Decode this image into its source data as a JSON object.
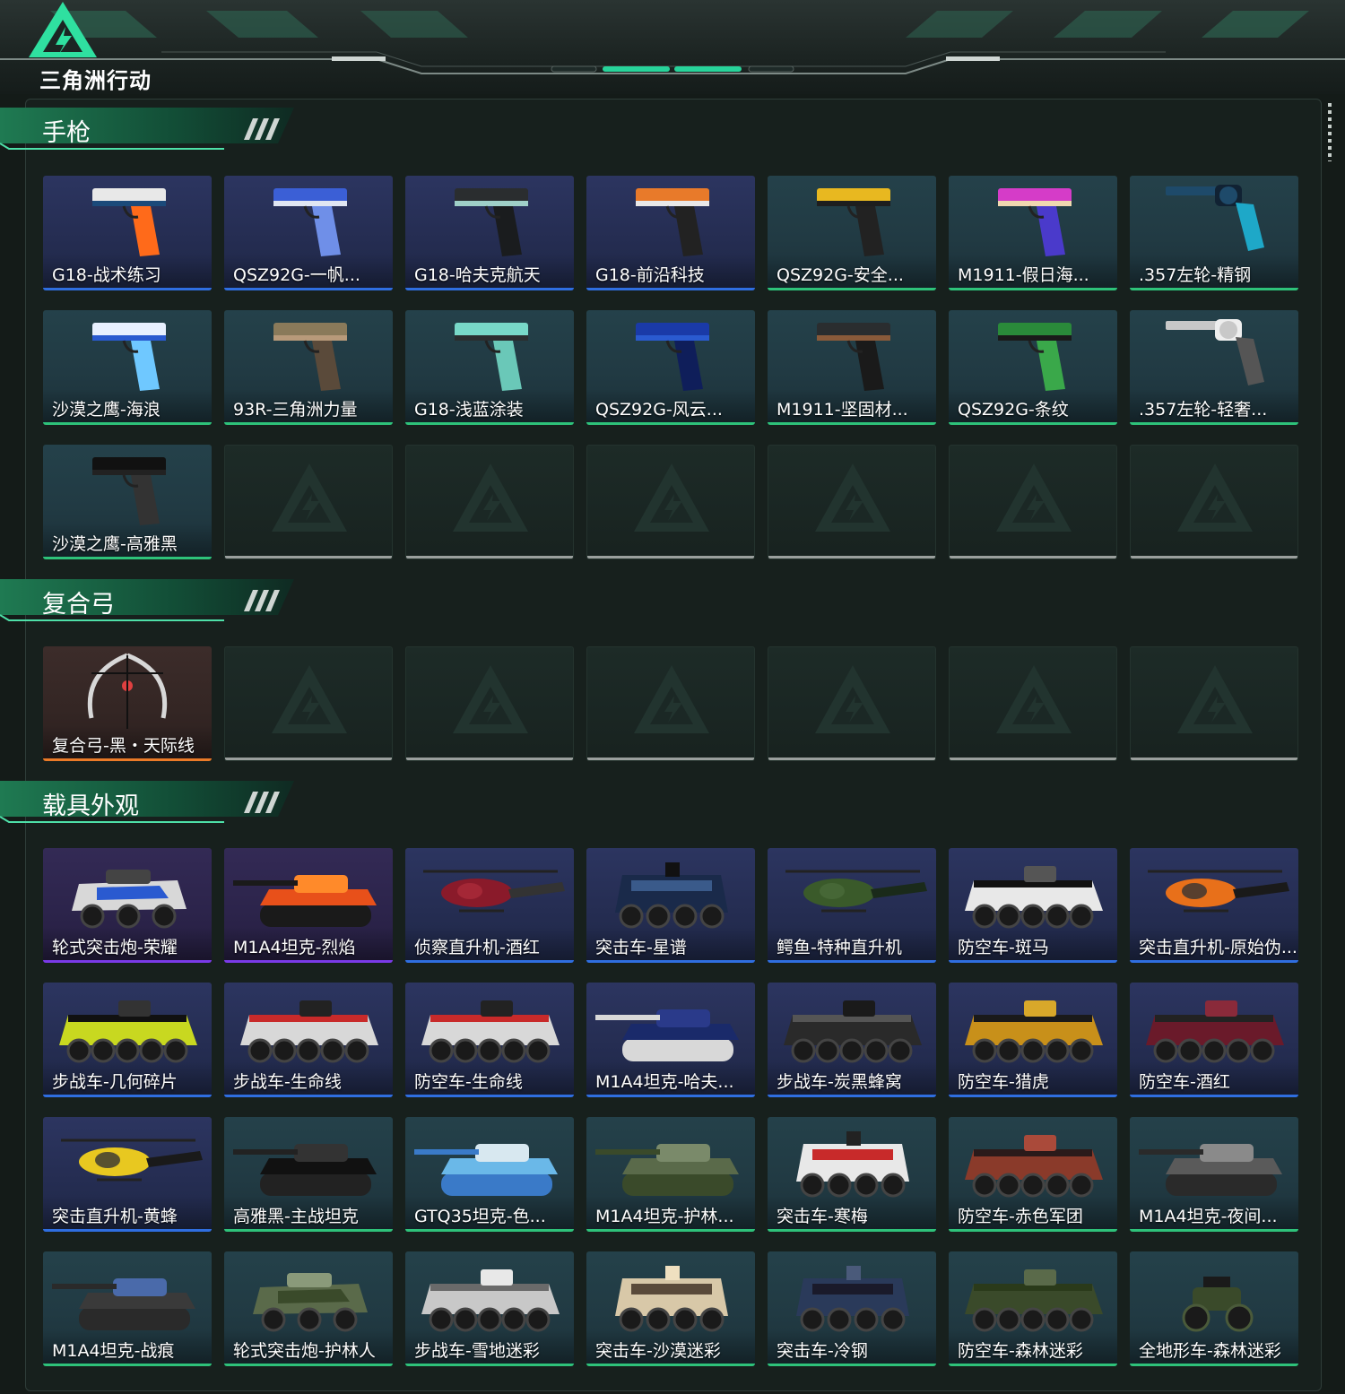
{
  "header": {
    "logo_text": "三角洲行动"
  },
  "sections": [
    {
      "title": "手枪",
      "rows": [
        [
          {
            "label": "G18-战术练习",
            "rarity": "blue",
            "icon": "pistol-icon",
            "colors": [
              "#e8e8e8",
              "#1b4a7a",
              "#ff6a1a"
            ]
          },
          {
            "label": "QSZ92G-一帆...",
            "rarity": "blue",
            "icon": "pistol-icon",
            "colors": [
              "#3b5fd6",
              "#e0e6f2",
              "#6f8fe8"
            ]
          },
          {
            "label": "G18-哈夫克航天",
            "rarity": "blue",
            "icon": "pistol-icon",
            "colors": [
              "#2a2d2f",
              "#9fd0c8",
              "#1a1c1e"
            ]
          },
          {
            "label": "G18-前沿科技",
            "rarity": "blue",
            "icon": "pistol-icon",
            "colors": [
              "#e87a2a",
              "#e8e8e8",
              "#222"
            ]
          },
          {
            "label": "QSZ92G-安全...",
            "rarity": "green",
            "icon": "pistol-icon",
            "colors": [
              "#e8b820",
              "#1e1e1e",
              "#222"
            ]
          },
          {
            "label": "M1911-假日海...",
            "rarity": "green",
            "icon": "pistol-icon",
            "colors": [
              "#d53cc8",
              "#f0d8b0",
              "#4a3acb"
            ]
          },
          {
            "label": ".357左轮-精钢",
            "rarity": "green",
            "icon": "revolver-icon",
            "colors": [
              "#1e4a6a",
              "#1ea8c8",
              "#123"
            ]
          }
        ],
        [
          {
            "label": "沙漠之鹰-海浪",
            "rarity": "green",
            "icon": "pistol-icon",
            "colors": [
              "#e8f0ff",
              "#2a5ad0",
              "#6fc8ff"
            ]
          },
          {
            "label": "93R-三角洲力量",
            "rarity": "green",
            "icon": "pistol-icon",
            "colors": [
              "#8a7a5a",
              "#b89a7a",
              "#5a4a3a"
            ]
          },
          {
            "label": "G18-浅蓝涂装",
            "rarity": "green",
            "icon": "pistol-icon",
            "colors": [
              "#78d8c8",
              "#2a2d2f",
              "#6ac8b8"
            ]
          },
          {
            "label": "QSZ92G-风云...",
            "rarity": "green",
            "icon": "pistol-icon",
            "colors": [
              "#1a3aa8",
              "#2a5ad0",
              "#0f1e5a"
            ]
          },
          {
            "label": "M1911-坚固材...",
            "rarity": "green",
            "icon": "pistol-icon",
            "colors": [
              "#2a2d2f",
              "#8a5a3a",
              "#1a1a1a"
            ]
          },
          {
            "label": "QSZ92G-条纹",
            "rarity": "green",
            "icon": "pistol-icon",
            "colors": [
              "#2a8a3a",
              "#1a1a1a",
              "#3aa84a"
            ]
          },
          {
            "label": ".357左轮-轻奢...",
            "rarity": "green",
            "icon": "revolver-icon",
            "colors": [
              "#c8c8c8",
              "#555",
              "#eee"
            ]
          }
        ],
        [
          {
            "label": "沙漠之鹰-高雅黑",
            "rarity": "green",
            "icon": "pistol-icon",
            "colors": [
              "#111",
              "#222",
              "#333"
            ]
          },
          null,
          null,
          null,
          null,
          null,
          null
        ]
      ]
    },
    {
      "title": "复合弓",
      "rows": [
        [
          {
            "label": "复合弓-黑・天际线",
            "rarity": "orange",
            "icon": "bow-icon",
            "colors": [
              "#d8d8d8",
              "#111",
              "#e04040"
            ]
          },
          null,
          null,
          null,
          null,
          null,
          null
        ]
      ]
    },
    {
      "title": "载具外观",
      "rows": [
        [
          {
            "label": "轮式突击炮-荣耀",
            "rarity": "purple",
            "icon": "armored-car-icon",
            "colors": [
              "#d8d8d8",
              "#2a5ad0",
              "#444"
            ]
          },
          {
            "label": "M1A4坦克-烈焰",
            "rarity": "purple",
            "icon": "tank-icon",
            "colors": [
              "#e8501a",
              "#1a1a1a",
              "#ff8a2a"
            ]
          },
          {
            "label": "侦察直升机-酒红",
            "rarity": "blue",
            "icon": "helicopter-icon",
            "colors": [
              "#8a1a2a",
              "#333",
              "#aa2a3a"
            ]
          },
          {
            "label": "突击车-星谱",
            "rarity": "blue",
            "icon": "truck-icon",
            "colors": [
              "#1a2a4a",
              "#3a5a8a",
              "#111"
            ]
          },
          {
            "label": "鳄鱼-特种直升机",
            "rarity": "blue",
            "icon": "helicopter-icon",
            "colors": [
              "#3a5a2a",
              "#1a2a1a",
              "#4a6a3a"
            ]
          },
          {
            "label": "防空车-斑马",
            "rarity": "blue",
            "icon": "apc-icon",
            "colors": [
              "#e8e8e8",
              "#111",
              "#555"
            ]
          },
          {
            "label": "突击直升机-原始伪...",
            "rarity": "blue",
            "icon": "helicopter-icon",
            "colors": [
              "#e8701a",
              "#1a1a1a",
              "#333"
            ]
          }
        ],
        [
          {
            "label": "步战车-几何碎片",
            "rarity": "blue",
            "icon": "apc-icon",
            "colors": [
              "#c8d820",
              "#111",
              "#333"
            ]
          },
          {
            "label": "步战车-生命线",
            "rarity": "blue",
            "icon": "apc-icon",
            "colors": [
              "#d8d8d8",
              "#c82a2a",
              "#222"
            ]
          },
          {
            "label": "防空车-生命线",
            "rarity": "blue",
            "icon": "apc-icon",
            "colors": [
              "#d8d8d8",
              "#c82a2a",
              "#222"
            ]
          },
          {
            "label": "M1A4坦克-哈夫...",
            "rarity": "blue",
            "icon": "tank-icon",
            "colors": [
              "#1a2a6a",
              "#d8d8d8",
              "#2a3a8a"
            ]
          },
          {
            "label": "步战车-炭黑蜂窝",
            "rarity": "blue",
            "icon": "apc-icon",
            "colors": [
              "#2a2a2a",
              "#555",
              "#1a1a1a"
            ]
          },
          {
            "label": "防空车-猎虎",
            "rarity": "blue",
            "icon": "apc-icon",
            "colors": [
              "#c8901a",
              "#1a1a1a",
              "#d8a82a"
            ]
          },
          {
            "label": "防空车-酒红",
            "rarity": "blue",
            "icon": "apc-icon",
            "colors": [
              "#6a1a2a",
              "#222",
              "#8a2a3a"
            ]
          }
        ],
        [
          {
            "label": "突击直升机-黄蜂",
            "rarity": "blue",
            "icon": "helicopter-icon",
            "colors": [
              "#e8c820",
              "#1a1a1a",
              "#333"
            ]
          },
          {
            "label": "高雅黑-主战坦克",
            "rarity": "green",
            "icon": "tank-icon",
            "colors": [
              "#111",
              "#222",
              "#333"
            ]
          },
          {
            "label": "GTQ35坦克-色...",
            "rarity": "green",
            "icon": "tank-icon",
            "colors": [
              "#6ab8e8",
              "#3a7ac8",
              "#d8e8f0"
            ]
          },
          {
            "label": "M1A4坦克-护林...",
            "rarity": "green",
            "icon": "tank-icon",
            "colors": [
              "#5a6a4a",
              "#3a4a2a",
              "#7a8a6a"
            ]
          },
          {
            "label": "突击车-寒梅",
            "rarity": "green",
            "icon": "truck-icon",
            "colors": [
              "#e8e8e8",
              "#c82a2a",
              "#222"
            ]
          },
          {
            "label": "防空车-赤色军团",
            "rarity": "green",
            "icon": "apc-icon",
            "colors": [
              "#8a3a2a",
              "#2a1a1a",
              "#aa4a3a"
            ]
          },
          {
            "label": "M1A4坦克-夜间...",
            "rarity": "green",
            "icon": "tank-icon",
            "colors": [
              "#5a5a5a",
              "#2a2a2a",
              "#8a8a8a"
            ]
          }
        ],
        [
          {
            "label": "M1A4坦克-战痕",
            "rarity": "green",
            "icon": "tank-icon",
            "colors": [
              "#3a3a3a",
              "#2a2a2a",
              "#4a6aaa"
            ]
          },
          {
            "label": "轮式突击炮-护林人",
            "rarity": "green",
            "icon": "armored-car-icon",
            "colors": [
              "#5a6a4a",
              "#3a4a2a",
              "#8a9a7a"
            ]
          },
          {
            "label": "步战车-雪地迷彩",
            "rarity": "green",
            "icon": "apc-icon",
            "colors": [
              "#c8c8c8",
              "#6a6a6a",
              "#e8e8e8"
            ]
          },
          {
            "label": "突击车-沙漠迷彩",
            "rarity": "green",
            "icon": "truck-icon",
            "colors": [
              "#d8c8a8",
              "#5a4a3a",
              "#efe0c0"
            ]
          },
          {
            "label": "突击车-冷钢",
            "rarity": "green",
            "icon": "truck-icon",
            "colors": [
              "#2a3a5a",
              "#1a1a2a",
              "#4a5a7a"
            ]
          },
          {
            "label": "防空车-森林迷彩",
            "rarity": "green",
            "icon": "apc-icon",
            "colors": [
              "#3a4a2a",
              "#2a3a1a",
              "#5a6a4a"
            ]
          },
          {
            "label": "全地形车-森林迷彩",
            "rarity": "green",
            "icon": "atv-icon",
            "colors": [
              "#3a4a2a",
              "#1a1a1a",
              "#4a5a3a"
            ]
          }
        ]
      ]
    }
  ],
  "rarity_colors": {
    "blue": "#2f6ee0",
    "green": "#2ec27a",
    "orange": "#ea7a28",
    "purple": "#7a3ae8",
    "empty": "#9a9f9d"
  }
}
